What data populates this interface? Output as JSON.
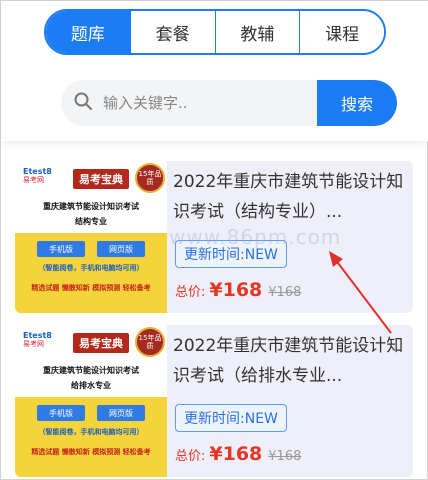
{
  "tabs": [
    {
      "label": "题库",
      "active": true
    },
    {
      "label": "套餐",
      "active": false
    },
    {
      "label": "教辅",
      "active": false
    },
    {
      "label": "课程",
      "active": false
    }
  ],
  "search": {
    "placeholder": "输入关键字..",
    "button_label": "搜索"
  },
  "items": [
    {
      "title": "2022年重庆市建筑节能设计知识考试（结构专业）...",
      "update": "更新时间:NEW",
      "price_label": "总价:",
      "price": "¥168",
      "old_price": "¥168",
      "cover": {
        "brand": "Etest8",
        "brand_sub": "易考网",
        "label": "易考宝典",
        "badge": "15年品质",
        "line1": "重庆建筑节能设计知识考试",
        "line2": "结构专业",
        "btn_app": "手机版",
        "btn_web": "网页版",
        "note": "（智能阅卷，手机和电脑均可用）",
        "footer_a": "精选试题",
        "footer_b": "懒散知新",
        "footer_c": "模拟预测",
        "footer_d": "轻松备考"
      }
    },
    {
      "title": "2022年重庆市建筑节能设计知识考试（给排水专业...",
      "update": "更新时间:NEW",
      "price_label": "总价:",
      "price": "¥168",
      "old_price": "¥168",
      "cover": {
        "brand": "Etest8",
        "brand_sub": "易考网",
        "label": "易考宝典",
        "badge": "15年品质",
        "line1": "重庆建筑节能设计知识考试",
        "line2": "给排水专业",
        "btn_app": "手机版",
        "btn_web": "网页版",
        "note": "（智能阅卷，手机和电脑均可用）",
        "footer_a": "精选试题",
        "footer_b": "懒散知新",
        "footer_c": "模拟预测",
        "footer_d": "轻松备考"
      }
    }
  ],
  "watermark": "www.86pm.com",
  "colors": {
    "accent": "#1b7cf3",
    "price": "#e53525",
    "card_bg": "#efeffa"
  }
}
